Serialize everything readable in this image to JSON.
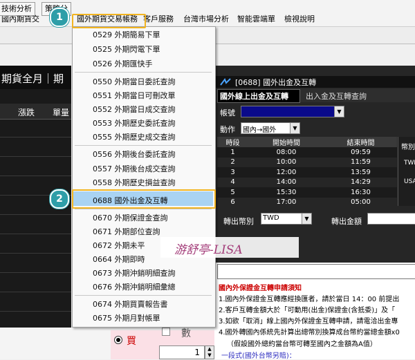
{
  "menubar": {
    "items": [
      "國內期貨交",
      "國外期貨交易帳務",
      "客戶服務",
      "台灣市場分析",
      "智能雲端單",
      "檢視說明"
    ]
  },
  "toolbar": {
    "buttons": [
      "技術分析",
      "策略分"
    ]
  },
  "left_panel": {
    "title": "期貨全月｜期",
    "col_change": "漲跌",
    "col_volume": "單量"
  },
  "dropdown": {
    "items": [
      "0529 外期簡易下單",
      "0525 外期閃電下單",
      "0526 外期匯快手",
      "0550 外期當日委託查詢",
      "0551 外期當日可刪改單",
      "0552 外期當日成交查詢",
      "0553 外期歷史委託查詢",
      "0555 外期歷史成交查詢",
      "0556 外期後台委託查詢",
      "0557 外期後台成交查詢",
      "0558 外期歷史損益查詢",
      "0688 國外出金及互轉",
      "0670 外期保證金查詢",
      "0671 外期部位查詢",
      "0672 外期未平",
      "0664 外期即時",
      "0673 外期沖銷明細查詢",
      "0676 外期沖銷明細彙總",
      "0674 外期買賣報告書",
      "0675 外期月對帳單"
    ],
    "highlighted": "0688 國外出金及互轉"
  },
  "badges": {
    "one": "1",
    "two": "2"
  },
  "watermark": "游舒亭-LISA",
  "window": {
    "title": "[0688] 國外出金及互轉",
    "tab_active": "國外線上出金及互轉",
    "tab_inactive": "出入金及互轉查詢",
    "account_label": "帳號",
    "action_label": "動作",
    "action_value": "國內→國外",
    "schedule_headers": [
      "時段",
      "開始時間",
      "結束時間"
    ],
    "schedule": [
      [
        "1",
        "08:00",
        "09:59"
      ],
      [
        "2",
        "10:00",
        "11:59"
      ],
      [
        "3",
        "12:00",
        "13:59"
      ],
      [
        "4",
        "14:00",
        "14:29"
      ],
      [
        "5",
        "15:30",
        "16:30"
      ],
      [
        "6",
        "17:00",
        "05:00"
      ]
    ],
    "ccy_header": "幣別",
    "ccy_1": "TWD",
    "ccy_2": "USA",
    "out_ccy_label": "轉出幣別",
    "out_ccy_value": "TWD",
    "out_amount_label": "轉出金額",
    "notice_title": "國內外保證金互轉申請須知",
    "notice": [
      "1.國內外保證金互轉應經換匯者，請於當日 14：00 前提出",
      "2.客戶互轉金額大於「可動用(出金)保證金(含抵委)」及「",
      "3.如欲「取消」線上國內外保證金互轉申請，請電洽出金專",
      "4.國外轉國內係統先計算出總幣別換算成台幣約當總金額x0",
      "（假設國外總約當台幣可轉至國內之金額為A值）",
      "一段式(國外台幣另賠)："
    ]
  },
  "order": {
    "buy_label": "買",
    "qty_label": "數",
    "qty_value": "1"
  }
}
